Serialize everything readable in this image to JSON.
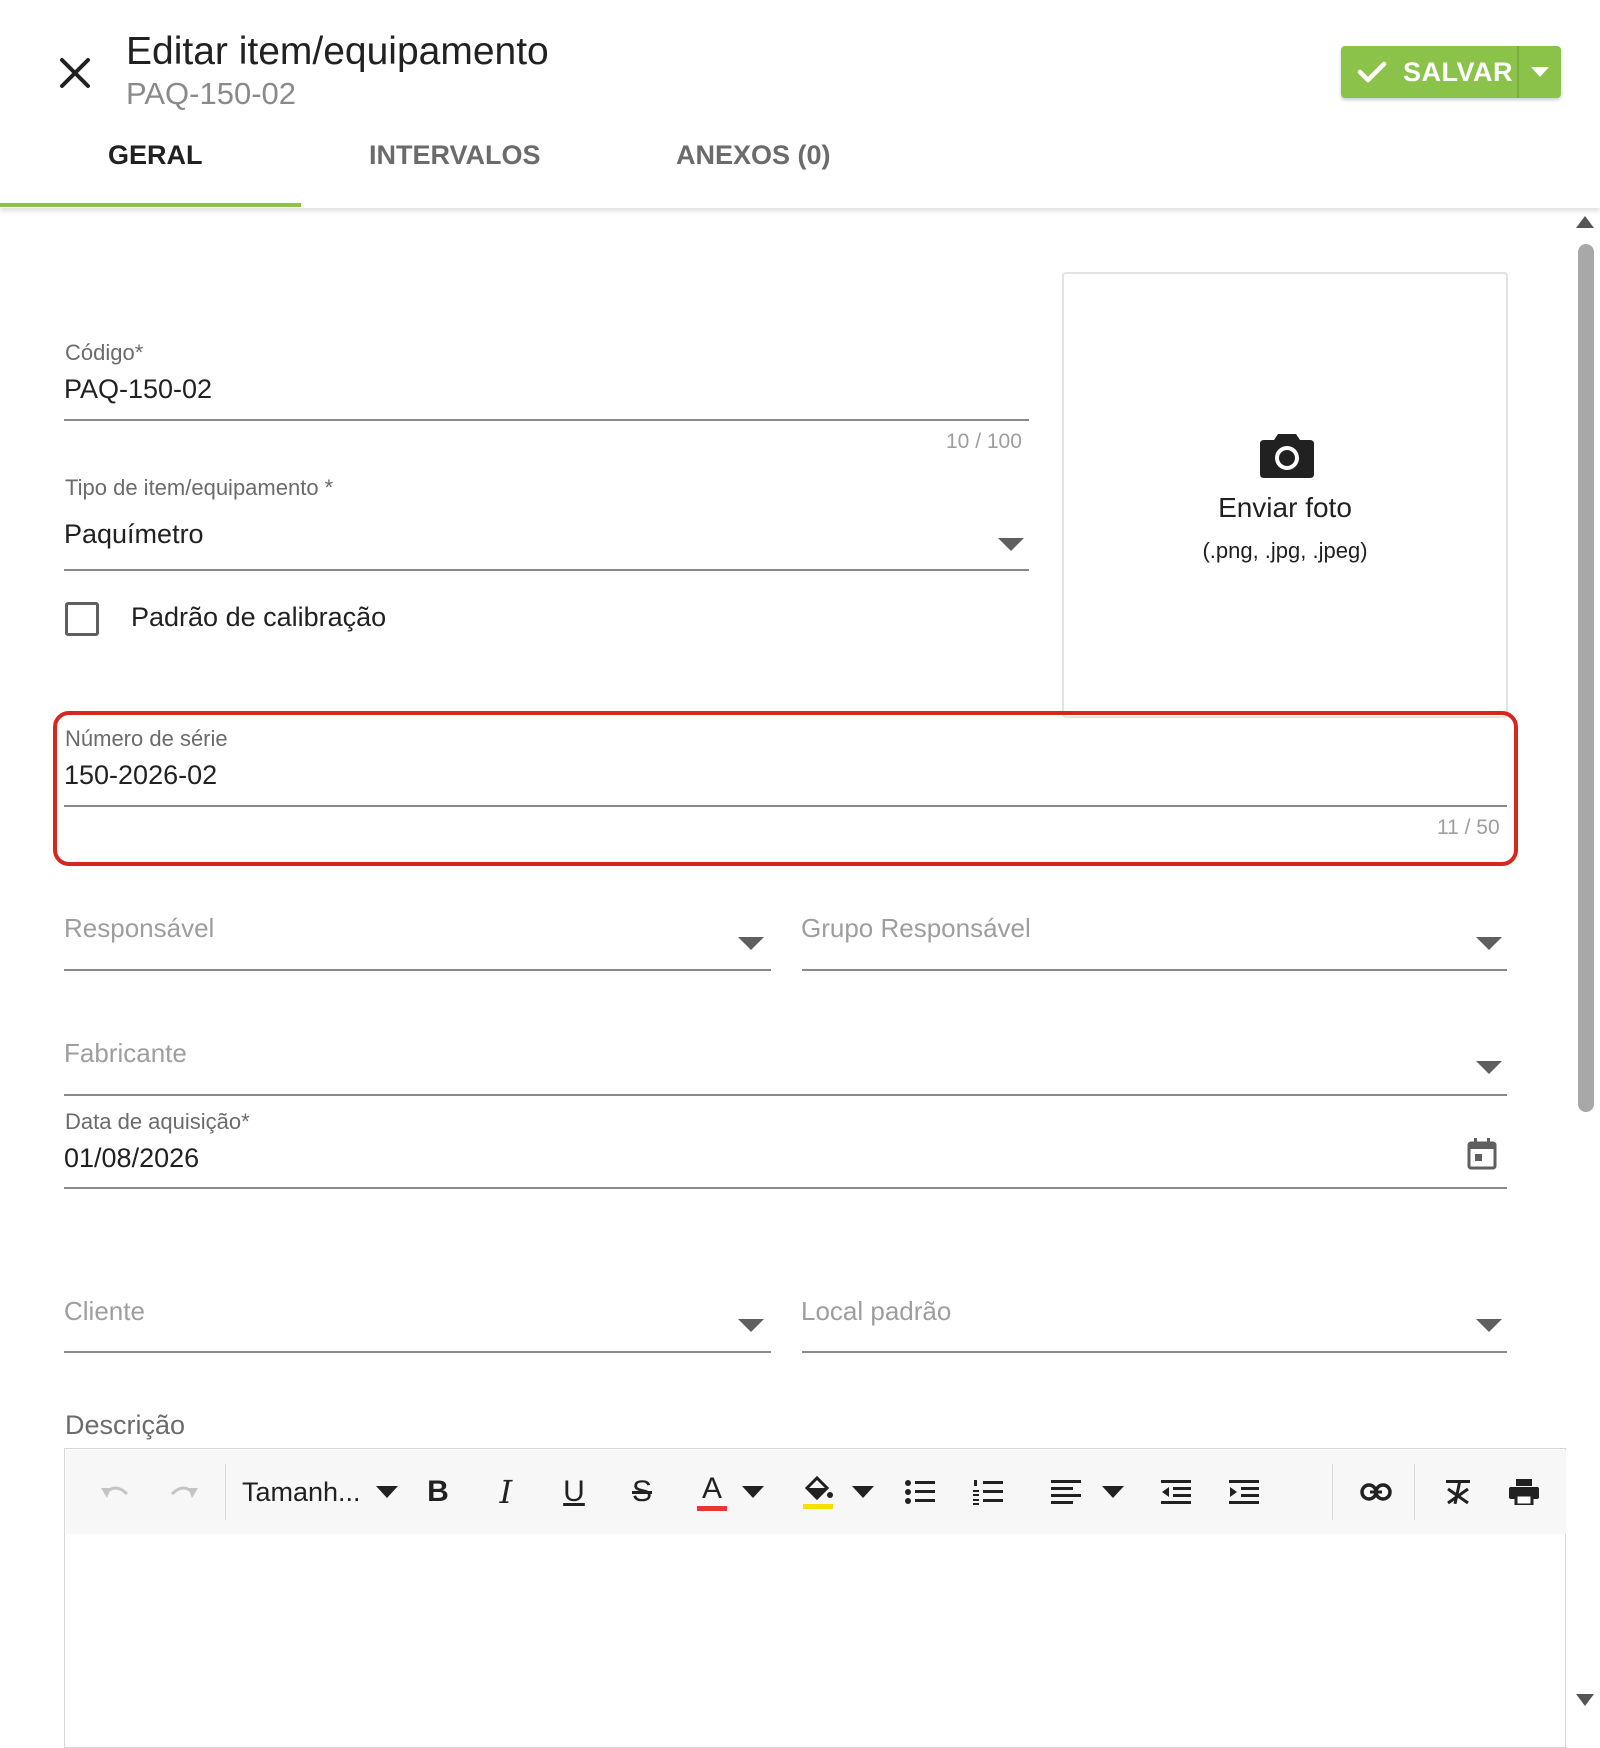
{
  "header": {
    "title": "Editar item/equipamento",
    "subtitle": "PAQ-150-02",
    "save_label": "SALVAR",
    "accent_color": "#8bc34a"
  },
  "tabs": [
    {
      "label": "GERAL",
      "active": true
    },
    {
      "label": "INTERVALOS",
      "active": false
    },
    {
      "label": "ANEXOS (0)",
      "active": false
    }
  ],
  "form": {
    "codigo": {
      "label": "Código*",
      "value": "PAQ-150-02",
      "counter": "10 / 100"
    },
    "tipo": {
      "label": "Tipo de item/equipamento *",
      "value": "Paquímetro"
    },
    "padrao": {
      "label": "Padrão de calibração",
      "checked": false
    },
    "serie": {
      "label": "Número de série",
      "value": "150-2026-02",
      "counter": "11 / 50"
    },
    "responsavel": {
      "placeholder": "Responsável"
    },
    "grupo": {
      "placeholder": "Grupo Responsável"
    },
    "fabricante": {
      "placeholder": "Fabricante"
    },
    "data": {
      "label": "Data de aquisição*",
      "value": "01/08/2026"
    },
    "cliente": {
      "placeholder": "Cliente"
    },
    "local": {
      "placeholder": "Local padrão"
    },
    "descricao": {
      "label": "Descrição"
    }
  },
  "photo": {
    "label": "Enviar foto",
    "formats": "(.png, .jpg, .jpeg)",
    "icon": "camera-icon"
  },
  "editor": {
    "size_label": "Tamanh...",
    "bold": "B",
    "italic": "I",
    "underline": "U",
    "strike": "S",
    "font_color_glyph": "A",
    "font_color": "#e53935",
    "highlight_color": "#f5e000"
  },
  "highlight_color": "#d7261e"
}
